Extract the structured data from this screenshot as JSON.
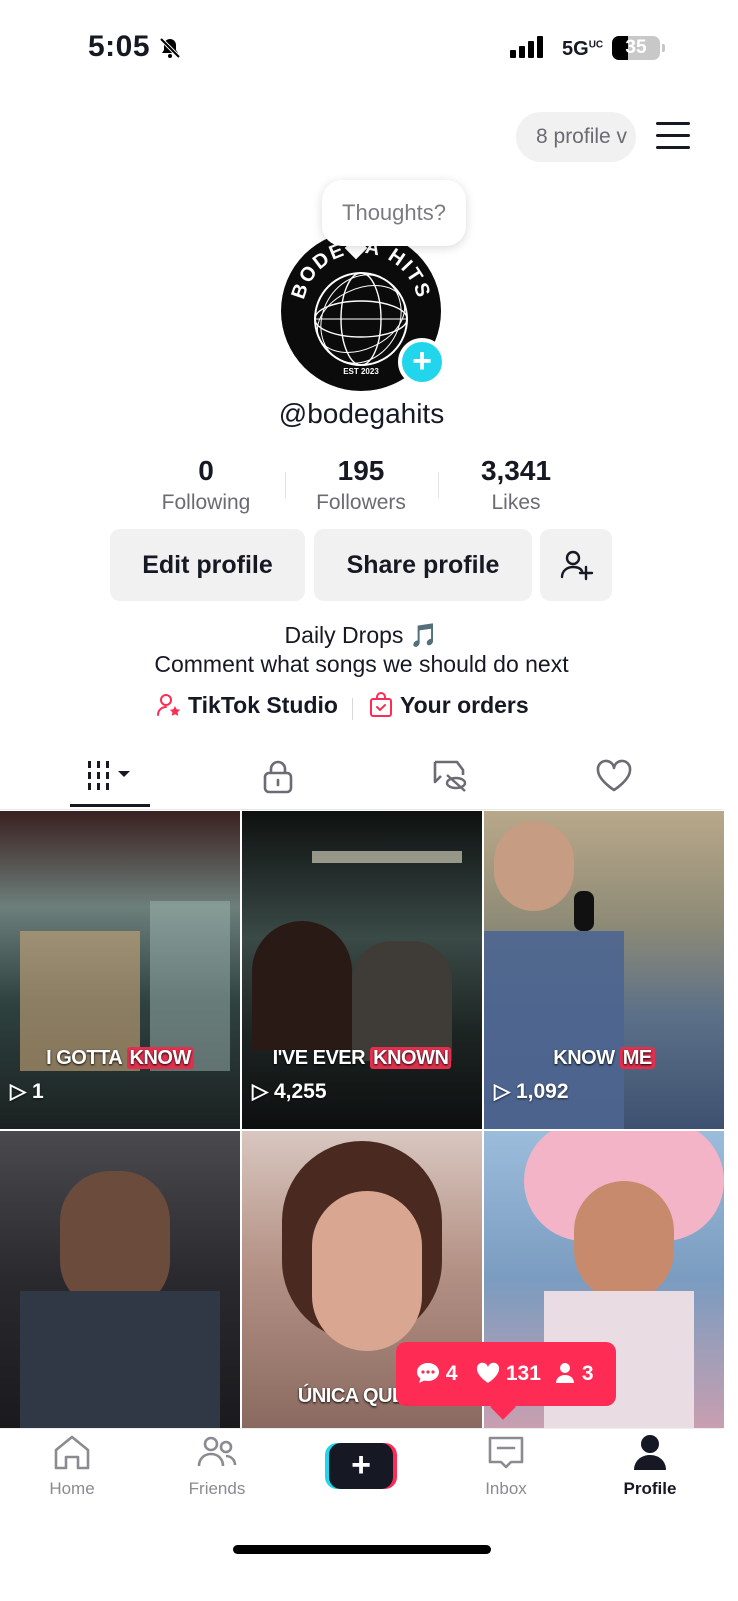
{
  "status_bar": {
    "time": "5:05",
    "network": "5G",
    "network_sup": "UC",
    "battery": "35"
  },
  "header": {
    "profile_views": "8 profile v"
  },
  "profile": {
    "bubble": "Thoughts?",
    "avatar_text_top": "BODEGA HITS",
    "avatar_text_bottom": "EST 2023",
    "username": "@bodegahits",
    "stats": [
      {
        "value": "0",
        "label": "Following"
      },
      {
        "value": "195",
        "label": "Followers"
      },
      {
        "value": "3,341",
        "label": "Likes"
      }
    ],
    "edit_button": "Edit profile",
    "share_button": "Share profile",
    "bio_line1": "Daily Drops 🎵",
    "bio_line2": "Comment what songs we should do next",
    "studio_link": "TikTok Studio",
    "orders_link": "Your orders"
  },
  "tabs": [
    "videos-icon",
    "lock-icon",
    "tagged-icon",
    "heart-icon"
  ],
  "videos": [
    {
      "caption_a": "I GOTTA ",
      "caption_b": "KNOW",
      "views": "1",
      "bg": "#3b4a48"
    },
    {
      "caption_a": "I'VE EVER ",
      "caption_b": "KNOWN",
      "views": "4,255",
      "bg": "#1c2422"
    },
    {
      "caption_a": "KNOW ",
      "caption_b": "ME",
      "views": "1,092",
      "bg": "#6e7b7d"
    },
    {
      "caption_a": "",
      "caption_b": "",
      "views": "",
      "bg": "#2a2a2e"
    },
    {
      "caption_a": "ÚNICA QUE M",
      "caption_b": "",
      "views": "",
      "bg": "#b59286"
    },
    {
      "caption_a": "",
      "caption_b": "",
      "views": "",
      "bg": "#7a9cc0"
    }
  ],
  "notification": {
    "comments": "4",
    "likes": "131",
    "followers": "3"
  },
  "nav": {
    "home": "Home",
    "friends": "Friends",
    "inbox": "Inbox",
    "profile": "Profile"
  },
  "colors": {
    "accent": "#fe2c55",
    "cyan": "#20d5ec"
  }
}
